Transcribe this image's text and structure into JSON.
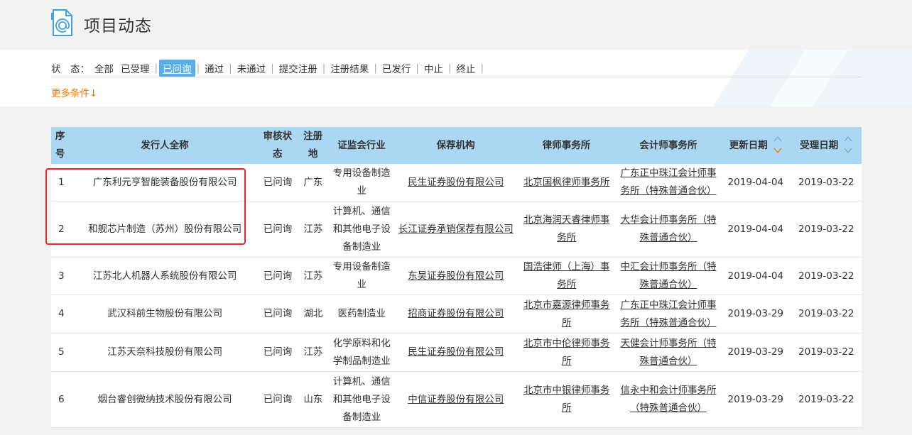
{
  "header": {
    "title": "项目动态",
    "icon": "document-at-icon"
  },
  "filters": {
    "status_label": "状　态：",
    "statuses": [
      {
        "label": "全部",
        "active": false
      },
      {
        "label": "已受理",
        "active": false
      },
      {
        "label": "已问询",
        "active": true
      },
      {
        "label": "通过",
        "active": false
      },
      {
        "label": "未通过",
        "active": false
      },
      {
        "label": "提交注册",
        "active": false
      },
      {
        "label": "注册结果",
        "active": false
      },
      {
        "label": "已发行",
        "active": false
      },
      {
        "label": "中止",
        "active": false
      },
      {
        "label": "终止",
        "active": false
      }
    ],
    "more_conditions": "更多条件↓"
  },
  "table": {
    "headers": {
      "index": "序号",
      "issuer": "发行人全称",
      "status": "审核状态",
      "place": "注册地",
      "industry": "证监会行业",
      "sponsor": "保荐机构",
      "law_firm": "律师事务所",
      "accounting_firm": "会计师事务所",
      "update_date": "更新日期",
      "accept_date": "受理日期"
    },
    "rows": [
      {
        "index": "1",
        "issuer": "广东利元亨智能装备股份有限公司",
        "status": "已问询",
        "place": "广东",
        "industry": "专用设备制造业",
        "sponsor": "民生证券股份有限公司",
        "law_firm": "北京国枫律师事务所",
        "accounting_firm": "广东正中珠江会计师事务所（特殊普通合伙）",
        "update_date": "2019-04-04",
        "accept_date": "2019-03-22"
      },
      {
        "index": "2",
        "issuer": "和舰芯片制造（苏州）股份有限公司",
        "status": "已问询",
        "place": "江苏",
        "industry": "计算机、通信和其他电子设备制造业",
        "sponsor": "长江证券承销保荐有限公司",
        "law_firm": "北京海润天睿律师事务所",
        "accounting_firm": "大华会计师事务所（特殊普通合伙）",
        "update_date": "2019-04-04",
        "accept_date": "2019-03-22"
      },
      {
        "index": "3",
        "issuer": "江苏北人机器人系统股份有限公司",
        "status": "已问询",
        "place": "江苏",
        "industry": "专用设备制造业",
        "sponsor": "东吴证券股份有限公司",
        "law_firm": "国浩律师（上海）事务所",
        "accounting_firm": "中汇会计师事务所（特殊普通合伙）",
        "update_date": "2019-04-04",
        "accept_date": "2019-03-22"
      },
      {
        "index": "4",
        "issuer": "武汉科前生物股份有限公司",
        "status": "已问询",
        "place": "湖北",
        "industry": "医药制造业",
        "sponsor": "招商证券股份有限公司",
        "law_firm": "北京市嘉源律师事务所",
        "accounting_firm": "广东正中珠江会计师事务所（特殊普通合伙）",
        "update_date": "2019-03-29",
        "accept_date": "2019-03-22"
      },
      {
        "index": "5",
        "issuer": "江苏天奈科技股份有限公司",
        "status": "已问询",
        "place": "江苏",
        "industry": "化学原料和化学制品制造业",
        "sponsor": "民生证券股份有限公司",
        "law_firm": "北京市中伦律师事务所",
        "accounting_firm": "天健会计师事务所（特殊普通合伙）",
        "update_date": "2019-03-29",
        "accept_date": "2019-03-22"
      },
      {
        "index": "6",
        "issuer": "烟台睿创微纳技术股份有限公司",
        "status": "已问询",
        "place": "山东",
        "industry": "计算机、通信和其他电子设备制造业",
        "sponsor": "中信证券股份有限公司",
        "law_firm": "北京市中银律师事务所",
        "accounting_firm": "信永中和会计师事务所（特殊普通合伙）",
        "update_date": "2019-03-29",
        "accept_date": "2019-03-22"
      }
    ]
  },
  "colors": {
    "header_bg": "#aad8f2",
    "active_filter": "#5aaee6",
    "more_link": "#f07800",
    "highlight_box": "#e8252d"
  }
}
